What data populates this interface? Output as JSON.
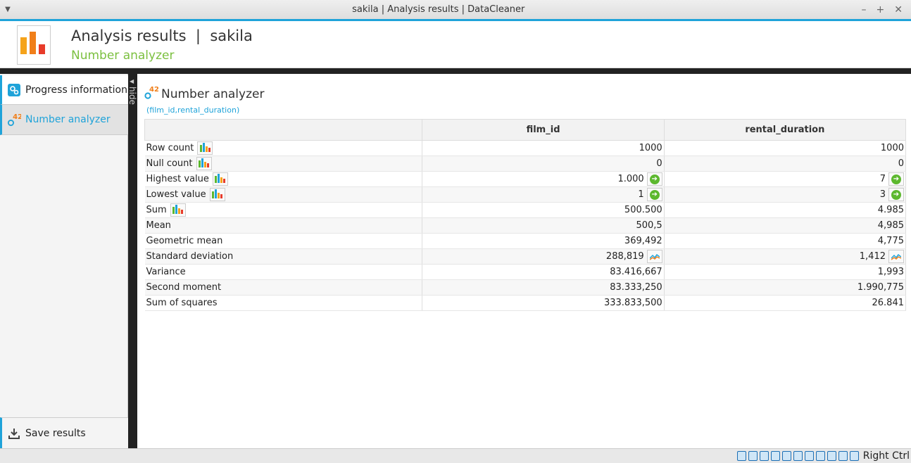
{
  "window": {
    "title": "sakila | Analysis results | DataCleaner",
    "controls": [
      "–",
      "+",
      "✕"
    ]
  },
  "header": {
    "title": "Analysis results  |  sakila",
    "subtitle": "Number analyzer"
  },
  "sidebar": {
    "items": [
      {
        "label": "Progress information",
        "icon": "gears-icon"
      },
      {
        "label": "Number analyzer",
        "icon": "number-analyzer-icon",
        "badge": "42"
      }
    ],
    "save": {
      "label": "Save results",
      "icon": "download-icon"
    },
    "hide_label": "hide"
  },
  "analyzer": {
    "title": "Number analyzer",
    "badge": "42",
    "columns_hint": "(film_id,rental_duration)",
    "headers": [
      "",
      "film_id",
      "rental_duration"
    ],
    "rows": [
      {
        "label": "Row count",
        "chart": true,
        "film_id": "1000",
        "rental_duration": "1000"
      },
      {
        "label": "Null count",
        "chart": true,
        "film_id": "0",
        "rental_duration": "0"
      },
      {
        "label": "Highest value",
        "chart": true,
        "film_id": "1.000",
        "rental_duration": "7",
        "go": true
      },
      {
        "label": "Lowest value",
        "chart": true,
        "film_id": "1",
        "rental_duration": "3",
        "go": true
      },
      {
        "label": "Sum",
        "chart": true,
        "film_id": "500.500",
        "rental_duration": "4.985"
      },
      {
        "label": "Mean",
        "film_id": "500,5",
        "rental_duration": "4,985"
      },
      {
        "label": "Geometric mean",
        "film_id": "369,492",
        "rental_duration": "4,775"
      },
      {
        "label": "Standard deviation",
        "film_id": "288,819",
        "rental_duration": "1,412",
        "stat": true
      },
      {
        "label": "Variance",
        "film_id": "83.416,667",
        "rental_duration": "1,993"
      },
      {
        "label": "Second moment",
        "film_id": "83.333,250",
        "rental_duration": "1.990,775"
      },
      {
        "label": "Sum of squares",
        "film_id": "333.833,500",
        "rental_duration": "26.841"
      }
    ]
  },
  "statusbar": {
    "host_key": "Right Ctrl"
  },
  "colors": {
    "accent": "#1fa3d9",
    "green": "#7cc040",
    "badge": "#f07f1a",
    "dark": "#222222"
  }
}
